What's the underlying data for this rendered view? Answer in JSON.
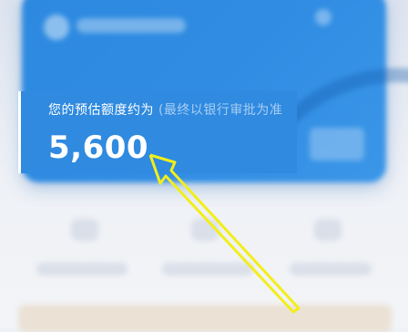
{
  "estimate": {
    "label": "您的预估额度约为",
    "note": "(最终以银行审批为准",
    "amount": "5,600"
  },
  "colors": {
    "card_blue": "#2f8ae0",
    "annotation_arrow": "#f2ee1a"
  },
  "annotation": {
    "icon": "arrow-annotation-icon"
  }
}
